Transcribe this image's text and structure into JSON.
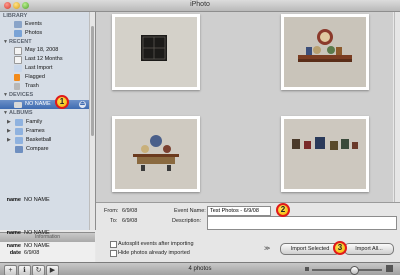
{
  "window": {
    "title": "iPhoto"
  },
  "sidebar": {
    "library_header": "LIBRARY",
    "library_items": [
      {
        "label": "Events",
        "icon": "events-icon"
      },
      {
        "label": "Photos",
        "icon": "photos-icon"
      }
    ],
    "recent_header": "RECENT",
    "recent_items": [
      {
        "label": "May 18, 2008",
        "icon": "calendar-icon"
      },
      {
        "label": "Last 12 Months",
        "icon": "calendar-icon"
      },
      {
        "label": "Last Import",
        "icon": "import-icon"
      },
      {
        "label": "Flagged",
        "icon": "flag-icon"
      },
      {
        "label": "Trash",
        "icon": "trash-icon"
      }
    ],
    "devices_header": "DEVICES",
    "device": {
      "label": "NO NAME",
      "icon": "camera-icon"
    },
    "albums_header": "ALBUMS",
    "albums": [
      {
        "label": "Family",
        "icon": "folder-icon"
      },
      {
        "label": "Frames",
        "icon": "folder-icon"
      },
      {
        "label": "Basketball",
        "icon": "folder-icon"
      },
      {
        "label": "Compare",
        "icon": "album-icon"
      }
    ]
  },
  "info": {
    "header": "Information",
    "rows": [
      {
        "key": "name",
        "value": "NO NAME"
      },
      {
        "key": "date",
        "value": "6/9/08"
      },
      {
        "key": "from",
        "value": "12:22:29 PM"
      },
      {
        "key": "to",
        "value": "12:18:18 PM"
      },
      {
        "key": "items",
        "value": "4 photos"
      },
      {
        "key": "size",
        "value": "10.2 MB"
      }
    ]
  },
  "import": {
    "from_label": "From:",
    "from_value": "6/9/08",
    "to_label": "To:",
    "to_value": "6/9/08",
    "event_name_label": "Event Name:",
    "event_name_value": "Test Photos - 6/9/08",
    "description_label": "Description:",
    "description_value": "",
    "autosplit_label": "Autosplit events after importing",
    "hide_label": "Hide photos already imported",
    "import_selected_label": "Import Selected",
    "import_all_label": "Import All..."
  },
  "status": {
    "photo_count": "4 photos"
  },
  "callouts": [
    "1",
    "2",
    "3"
  ],
  "colors": {
    "selection": "#3e6bb1",
    "callout_fill": "#f2b400",
    "callout_ring": "#e01a1a"
  }
}
